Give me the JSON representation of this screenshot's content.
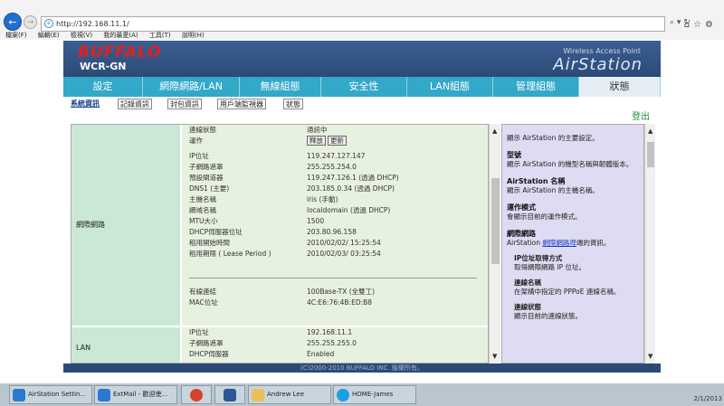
{
  "browser": {
    "url": "http://192.168.11.1/",
    "menu": [
      "檔案(F)",
      "編輯(E)",
      "檢視(V)",
      "我的最愛(A)",
      "工具(T)",
      "說明(H)"
    ]
  },
  "header": {
    "brand": "BUFFALO",
    "model": "WCR-GN",
    "product_line": "Wireless Access Point",
    "product": "AirStation"
  },
  "main_tabs": [
    "設定",
    "網際網路/LAN",
    "無線組態",
    "安全性",
    "LAN組態",
    "管理組態",
    "狀態"
  ],
  "sub_tabs": [
    "系統資訊",
    "記錄資訊",
    "封包資訊",
    "用戶端監視器",
    "狀態"
  ],
  "logout": "登出",
  "internet_section": {
    "label": "網際網路",
    "rows": [
      {
        "k": "連線狀態",
        "v": "通訊中"
      },
      {
        "k": "運作",
        "v": ""
      },
      {
        "k": "IP位址",
        "v": "119.247.127.147"
      },
      {
        "k": "子網路遮罩",
        "v": "255.255.254.0"
      },
      {
        "k": "預設閘道器",
        "v": "119.247.126.1 (透過 DHCP)"
      },
      {
        "k": "DNS1 (主要)",
        "v": "203.185.0.34 (透過 DHCP)"
      },
      {
        "k": "主機名稱",
        "v": "iris (手動)"
      },
      {
        "k": "網域名稱",
        "v": "localdomain (透過 DHCP)"
      },
      {
        "k": "MTU大小",
        "v": "1500"
      },
      {
        "k": "DHCP伺服器位址",
        "v": "203.80.96.158"
      },
      {
        "k": "租用開始時間",
        "v": "2010/02/02/ 15:25:54"
      },
      {
        "k": "租用期限 ( Lease Period )",
        "v": "2010/02/03/ 03:25:54"
      }
    ],
    "buttons": {
      "release": "釋放",
      "renew": "更新"
    },
    "wired": [
      {
        "k": "有線連結",
        "v": "100Base-TX (全雙工)"
      },
      {
        "k": "MAC位址",
        "v": "4C:E6:76:4B:ED:B8"
      }
    ]
  },
  "lan_section": {
    "label": "LAN",
    "rows": [
      {
        "k": "IP位址",
        "v": "192.168.11.1"
      },
      {
        "k": "子網路遮罩",
        "v": "255.255.255.0"
      },
      {
        "k": "DHCP伺服器",
        "v": "Enabled"
      }
    ]
  },
  "help": {
    "intro": "顯示 AirStation 的主要設定。",
    "sections": [
      {
        "title": "型號",
        "text": "顯示 AirStation 的機型名稱與韌體版本。"
      },
      {
        "title": "AirStation 名稱",
        "text": "顯示 AirStation 的主機名稱。"
      },
      {
        "title": "運作模式",
        "text": "會顯示目前的運作模式。"
      }
    ],
    "internet_title": "網際網路",
    "internet_pre": "AirStation ",
    "internet_link": "網際網路埠",
    "internet_post": "端的資訊。",
    "sub": [
      {
        "title": "IP位址取得方式",
        "text": "取得網際網路 IP 位址。"
      },
      {
        "title": "連線名稱",
        "text": "在架構中指定的 PPPoE 連線名稱。"
      },
      {
        "title": "連線狀態",
        "text": "顯示目前的連線狀態。"
      }
    ]
  },
  "footer": "(C)2000-2010 BUFFALO INC. 版權所有。",
  "taskbar": {
    "items": [
      "AirStation Settin...",
      "ExtMail - 歡迎使...",
      "",
      "",
      "Andrew Lee",
      "HOME-James"
    ],
    "clock": "2/1/2013"
  },
  "colors": {
    "tab": "#33a8c8",
    "header": "#2c4a76",
    "brand": "#e02020",
    "help_bg": "#dedcf2",
    "section": "#cbe8d7",
    "row": "#e7f1df"
  }
}
